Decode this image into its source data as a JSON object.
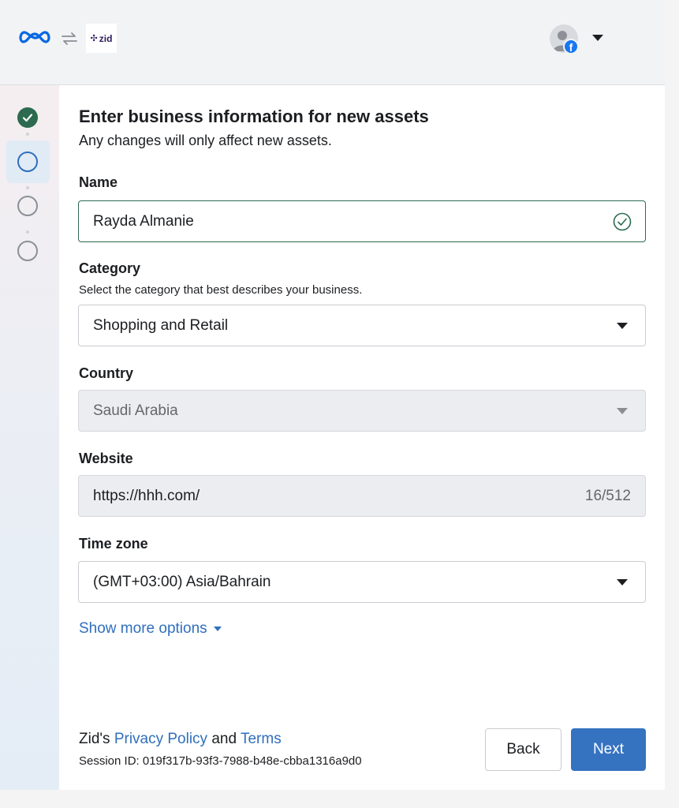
{
  "header": {
    "partner_logo_text": "zid",
    "icons": [
      "meta-logo",
      "swap-arrows-icon",
      "zid-logo",
      "avatar",
      "facebook-icon",
      "chevron-down-icon"
    ]
  },
  "stepper": {
    "steps": [
      "completed",
      "current",
      "upcoming",
      "upcoming"
    ]
  },
  "form": {
    "title": "Enter business information for new assets",
    "subtitle": "Any changes will only affect new assets.",
    "name": {
      "label": "Name",
      "value": "Rayda Almanie"
    },
    "category": {
      "label": "Category",
      "help": "Select the category that best describes your business.",
      "value": "Shopping and Retail"
    },
    "country": {
      "label": "Country",
      "value": "Saudi Arabia"
    },
    "website": {
      "label": "Website",
      "value": "https://hhh.com/",
      "counter": "16/512"
    },
    "timezone": {
      "label": "Time zone",
      "value": "(GMT+03:00) Asia/Bahrain"
    },
    "show_more": "Show more options"
  },
  "footer": {
    "legal_prefix": "Zid's",
    "privacy_link": "Privacy Policy",
    "legal_and": "and",
    "terms_link": "Terms",
    "session": "Session ID: 019f317b-93f3-7988-b48e-cbba1316a9d0",
    "back_label": "Back",
    "next_label": "Next"
  },
  "colors": {
    "accent": "#3573c1",
    "link": "#2f6fbd",
    "success": "#2d6a4f",
    "meta_blue": "#0668e1"
  }
}
